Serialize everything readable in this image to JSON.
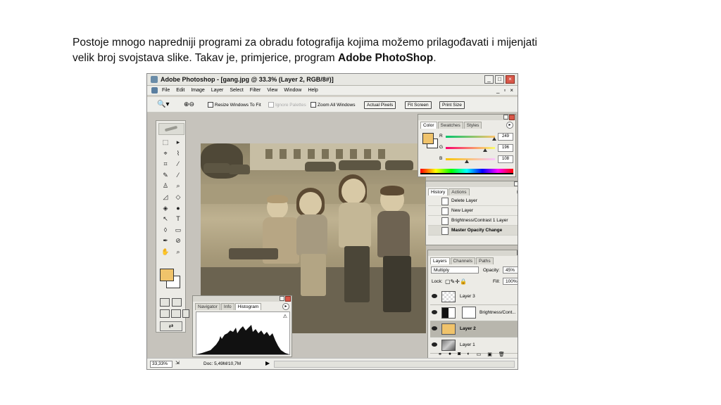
{
  "intro": {
    "line1": "Postoje mnogo napredniji programi za obradu fotografija kojima možemo prilagođavati i mijenjati",
    "line2_a": "velik broj svojstava slike. Takav je, primjerice, program ",
    "line2_b": "Adobe PhotoShop",
    "line2_c": "."
  },
  "window": {
    "title": "Adobe Photoshop - [gang.jpg @ 33.3% (Layer 2, RGB/8#)]",
    "controls": [
      "_",
      "□",
      "×"
    ]
  },
  "menu": {
    "items": [
      "File",
      "Edit",
      "Image",
      "Layer",
      "Select",
      "Filter",
      "View",
      "Window",
      "Help"
    ],
    "doc_controls": [
      "_",
      "▫",
      "×"
    ]
  },
  "options": {
    "resize_windows": "Resize Windows To Fit",
    "ignore_palettes": "Ignore Palettes",
    "zoom_all": "Zoom All Windows",
    "actual_pixels": "Actual Pixels",
    "fit_screen": "Fit Screen",
    "print_size": "Print Size"
  },
  "tools": [
    "⬚",
    "▸",
    "⌖",
    "⌇",
    "⌗",
    "⁄",
    "✎",
    "⁄",
    "♙",
    "⌕",
    "◿",
    "◇",
    "◈",
    "●",
    "↖",
    "T",
    "◊",
    "▭",
    "✒",
    "⊘",
    "✋",
    "⌕"
  ],
  "colors": {
    "foreground": "#f0c36b",
    "background": "#ffffff"
  },
  "color_panel": {
    "tabs": [
      "Color",
      "Swatches",
      "Styles"
    ],
    "r": {
      "label": "R",
      "value": "249"
    },
    "g": {
      "label": "G",
      "value": "196"
    },
    "b": {
      "label": "B",
      "value": "108"
    }
  },
  "history_panel": {
    "tabs": [
      "History",
      "Actions"
    ],
    "items": [
      "Delete Layer",
      "New Layer",
      "Brightness/Contrast 1 Layer",
      "Master Opacity Change"
    ]
  },
  "layers_panel": {
    "tabs": [
      "Layers",
      "Channels",
      "Paths"
    ],
    "blend_mode": "Multiply",
    "opacity_label": "Opacity:",
    "opacity_value": "45%",
    "lock_label": "Lock:",
    "fill_label": "Fill:",
    "fill_value": "100%",
    "layers": [
      "Layer 3",
      "Brightness/Cont...",
      "Layer 2",
      "Layer 1"
    ]
  },
  "histogram_panel": {
    "tabs": [
      "Navigator",
      "Info",
      "Histogram"
    ]
  },
  "status": {
    "zoom": "33,33%",
    "doc": "Doc: 5,49M/10,7M"
  }
}
